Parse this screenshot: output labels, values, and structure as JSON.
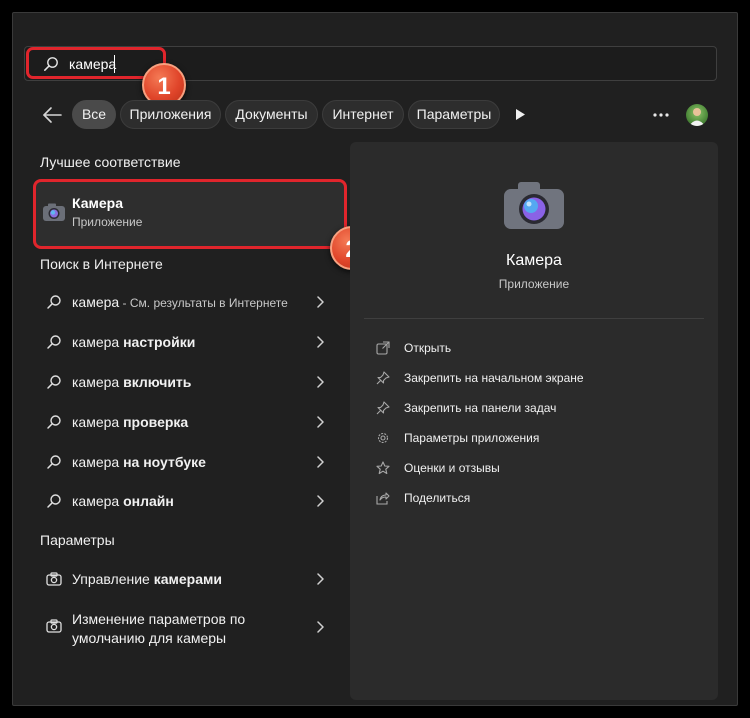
{
  "search": {
    "value": "камера"
  },
  "badges": {
    "first": "1",
    "second": "2"
  },
  "filters": {
    "all": "Все",
    "apps": "Приложения",
    "documents": "Документы",
    "internet": "Интернет",
    "settings": "Параметры"
  },
  "best_match": {
    "section": "Лучшее соответствие",
    "name": "Камера",
    "type": "Приложение"
  },
  "web_search": {
    "section": "Поиск в Интернете",
    "items": [
      {
        "query": "камера",
        "bold": "",
        "suffix": " - См. результаты в Интернете"
      },
      {
        "query": "камера ",
        "bold": "настройки",
        "suffix": ""
      },
      {
        "query": "камера ",
        "bold": "включить",
        "suffix": ""
      },
      {
        "query": "камера ",
        "bold": "проверка",
        "suffix": ""
      },
      {
        "query": "камера ",
        "bold": "на ноутбуке",
        "suffix": ""
      },
      {
        "query": "камера ",
        "bold": "онлайн",
        "suffix": ""
      }
    ]
  },
  "settings_section": {
    "section": "Параметры",
    "items": [
      {
        "plain": "Управление ",
        "bold": "камерами"
      },
      {
        "line1": "Изменение параметров по",
        "line2": "умолчанию для камеры"
      }
    ]
  },
  "detail": {
    "title": "Камера",
    "subtitle": "Приложение",
    "actions": [
      "Открыть",
      "Закрепить на начальном экране",
      "Закрепить на панели задач",
      "Параметры приложения",
      "Оценки и отзывы",
      "Поделиться"
    ]
  },
  "colors": {
    "background": "#202020",
    "highlight": "#e0252c",
    "badge": "#e0452a"
  }
}
